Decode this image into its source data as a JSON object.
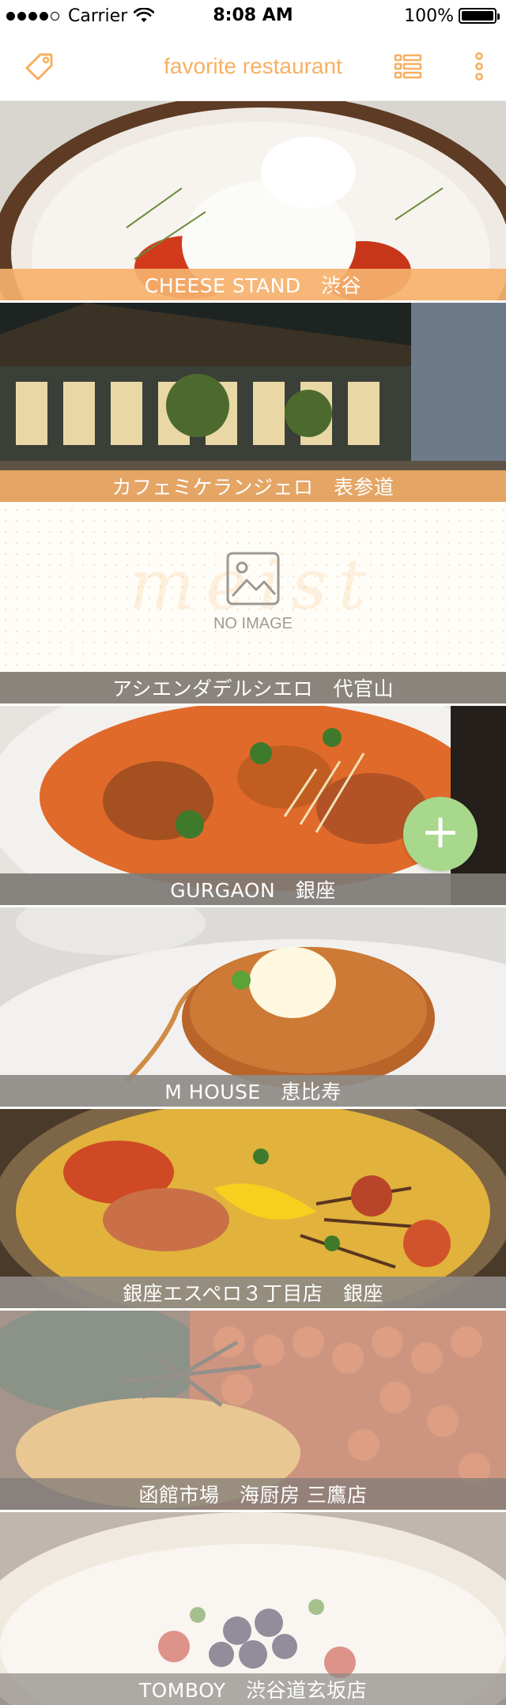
{
  "status_bar": {
    "carrier": "Carrier",
    "time": "8:08 AM",
    "battery": "100%"
  },
  "nav": {
    "title": "favorite restaurant",
    "left_icon": "tag-icon",
    "right_icon_list": "list-icon",
    "right_icon_more": "more-vertical-icon",
    "accent_color": "#f7b061"
  },
  "restaurants": [
    {
      "name": "CHEESE STAND　渋谷",
      "caption_color": "#f5b16d"
    },
    {
      "name": "カフェミケランジェロ　表参道",
      "caption_color": "#f0ad68"
    },
    {
      "name": "アシエンダデルシエロ　代官山",
      "caption_color": "#8a847d"
    },
    {
      "name": "GURGAON　銀座",
      "caption_color": "#7e7a75"
    },
    {
      "name": "M HOUSE　恵比寿",
      "caption_color": "#8f8b86"
    },
    {
      "name": "銀座エスペロ３丁目店　銀座",
      "caption_color": "#8e8a84"
    },
    {
      "name": "函館市場　海厨房 三鷹店",
      "caption_color": "#7f7b78"
    },
    {
      "name": "TOMBOY　渋谷道玄坂店",
      "caption_color": "#8d8985"
    }
  ],
  "no_image": {
    "label": "NO IMAGE",
    "brand": "meist"
  },
  "fab": {
    "label": "+",
    "color": "#a8d88c"
  }
}
